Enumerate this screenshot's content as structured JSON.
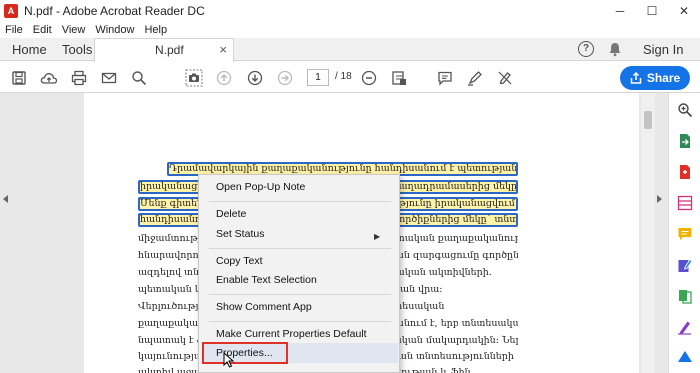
{
  "window": {
    "title": "N.pdf - Adobe Acrobat Reader DC",
    "controls": {
      "minimize": "─",
      "maximize": "☐",
      "close": "✕"
    }
  },
  "menu": [
    "File",
    "Edit",
    "View",
    "Window",
    "Help"
  ],
  "tabs": {
    "home": "Home",
    "tools": "Tools",
    "document": "N.pdf",
    "close": "×"
  },
  "header": {
    "help": "?",
    "signin": "Sign In"
  },
  "toolbar": {
    "page_current": "1",
    "page_total": "/ 18",
    "share_label": "Share"
  },
  "document_lines": [
    "Դրամավարկային քաղաքականությունը հանդիսանում է պետության կողմից",
    "իրականացվող տնտեսական քաղաքականության բաղադրամասերից մեկը:",
    "Մենք գիտենք, որ դրամավարկային քաղաքականությունը իրականացվում է ցեցումների և",
    "հանդիսանում է կառավարության կարևորագույն գործիքներից մեկը` տնտեսությունում պետության",
    "միջամտությունների քաղաքականության մեջ և պետական քաղաքականությունը",
    "հնարավորություն է տալիս կարգավորել տնտեսական զարգացումը գործընթացների",
    "ազդելով տնտեսության վրա դրամական և ֆինանսական ակտիվների.",
    "     պետական կառավարությունը ազդում է տնտեսության վրա:",
    "     Վերլուծությունը ցույց է տալիս, որ զարգացում տնտեսական",
    "քաղաքականության արդյունավետությունը բարձրանում է, երբ տնտեսական",
    "նպատակ է ձևավորվում և իրականացվում տնտեսական մակարդակին: Ներկա",
    "կայունության պահպանման նպատակով տնտեսական տնտեսությունների",
    "ակտիվ աջակցության միջոցով տնտեսական ակտիվության և ֆին"
  ],
  "context_menu": {
    "open_popup": "Open Pop-Up Note",
    "delete": "Delete",
    "set_status": "Set Status",
    "copy_text": "Copy Text",
    "enable_text_selection": "Enable Text Selection",
    "show_comment_app": "Show Comment App",
    "make_default": "Make Current Properties Default",
    "properties": "Properties..."
  },
  "colors": {
    "share": "#1473e6",
    "highlight_fill": "#fff3a8",
    "highlight_border": "#2b67c6",
    "callout": "#e0302a"
  }
}
